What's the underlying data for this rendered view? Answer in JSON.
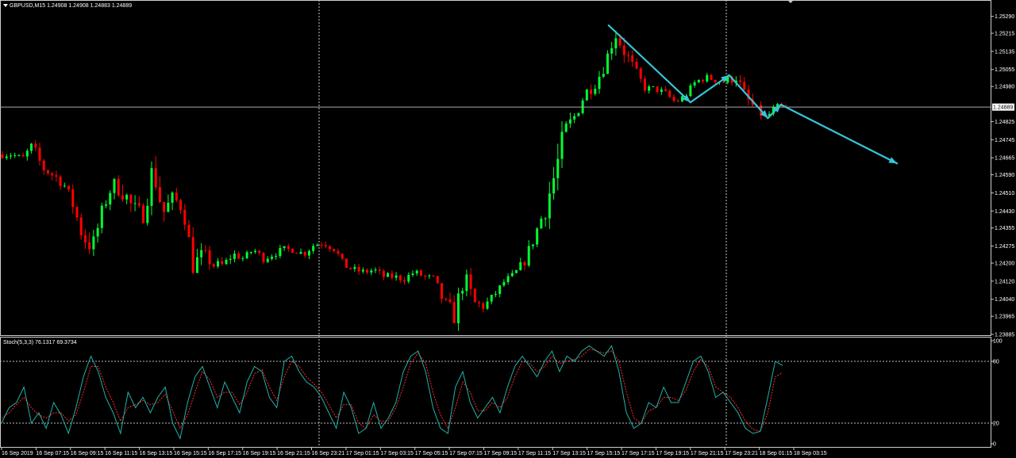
{
  "header": {
    "symbol_info": "GBPUSD,M15  1.24908 1.24908 1.24883 1.24889"
  },
  "current_price": {
    "label": "1.24889",
    "value": 1.24889
  },
  "colors": {
    "background": "#000000",
    "bull": "#00ff33",
    "bear": "#ff0000",
    "grid": "#c8c8c8",
    "axis_text": "#ffffff",
    "annotation": "#36c5d8",
    "stoch_main": "#20b2aa",
    "stoch_signal": "#ff2a2a"
  },
  "chart_data": [
    {
      "type": "candlestick",
      "symbol": "GBPUSD",
      "timeframe": "M15",
      "ohlc_header": {
        "open": 1.24908,
        "high": 1.24908,
        "low": 1.24883,
        "close": 1.24889
      },
      "ylim": [
        1.23885,
        1.2532
      ],
      "price_ticks": [
        "1.25290",
        "1.25215",
        "1.25135",
        "1.25055",
        "1.24980",
        "1.24825",
        "1.24745",
        "1.24665",
        "1.24590",
        "1.24510",
        "1.24430",
        "1.24355",
        "1.24275",
        "1.24200",
        "1.24120",
        "1.24040",
        "1.23965",
        "1.23885"
      ],
      "time_labels": [
        "16 Sep 2019",
        "16 Sep 07:15",
        "16 Sep 09:15",
        "16 Sep 11:15",
        "16 Sep 13:15",
        "16 Sep 15:15",
        "16 Sep 17:15",
        "16 Sep 19:15",
        "16 Sep 21:15",
        "16 Sep 23:21",
        "17 Sep 01:15",
        "17 Sep 03:15",
        "17 Sep 05:15",
        "17 Sep 07:15",
        "17 Sep 09:15",
        "17 Sep 11:15",
        "17 Sep 13:15",
        "17 Sep 15:15",
        "17 Sep 17:15",
        "17 Sep 19:15",
        "17 Sep 21:15",
        "17 Sep 23:21",
        "18 Sep 01:15",
        "18 Sep 03:15"
      ],
      "close_path": [
        1.2468,
        1.2468,
        1.2466,
        1.2472,
        1.2462,
        1.2459,
        1.2456,
        1.2446,
        1.2432,
        1.2427,
        1.2444,
        1.2455,
        1.2452,
        1.2444,
        1.2441,
        1.2462,
        1.2442,
        1.2449,
        1.2444,
        1.2419,
        1.2424,
        1.2419,
        1.2419,
        1.2424,
        1.2422,
        1.2426,
        1.2422,
        1.2424,
        1.2426,
        1.2426,
        1.2424,
        1.2428,
        1.2429,
        1.2427,
        1.2419,
        1.2417,
        1.2416,
        1.2417,
        1.2414,
        1.2414,
        1.2413,
        1.2416,
        1.2414,
        1.2413,
        1.2402,
        1.2397,
        1.2414,
        1.2402,
        1.2401,
        1.2406,
        1.2412,
        1.2415,
        1.2421,
        1.2432,
        1.2444,
        1.2459,
        1.2477,
        1.2485,
        1.2495,
        1.2499,
        1.2508,
        1.2522,
        1.2513,
        1.2505,
        1.2497,
        1.2497,
        1.2495,
        1.2491,
        1.2494,
        1.25,
        1.2502,
        1.2501,
        1.25,
        1.2503,
        1.2493,
        1.2488,
        1.2484,
        1.2489,
        1.2489
      ],
      "volatility": [
        2,
        2,
        2,
        3,
        3,
        3,
        4,
        4,
        6,
        6,
        4,
        4,
        6,
        5,
        5,
        8,
        6,
        4,
        4,
        6,
        4,
        3,
        3,
        2,
        2,
        2,
        2,
        2,
        2,
        2,
        2,
        2,
        2,
        3,
        2,
        2,
        2,
        2,
        2,
        2,
        2,
        2,
        2,
        2,
        4,
        6,
        5,
        5,
        3,
        2,
        2,
        2,
        3,
        4,
        7,
        9,
        8,
        4,
        4,
        3,
        4,
        5,
        5,
        3,
        2,
        2,
        2,
        2,
        2,
        2,
        2,
        2,
        3,
        4,
        4,
        3,
        2,
        2,
        1
      ],
      "candle_count": 190
    },
    {
      "type": "line",
      "indicator": "Stochastic",
      "title": "Stoch(5,3,3) 76.1317 69.3734",
      "params": [
        5,
        3,
        3
      ],
      "main_value": 76.1317,
      "signal_value": 69.3734,
      "ylim": [
        0,
        100
      ],
      "levels": [
        20,
        80
      ],
      "tick_labels": [
        "100",
        "80",
        "20",
        "0"
      ],
      "main_series": [
        20,
        35,
        40,
        55,
        20,
        30,
        15,
        40,
        28,
        10,
        35,
        65,
        85,
        70,
        45,
        30,
        10,
        50,
        35,
        45,
        30,
        45,
        55,
        20,
        5,
        40,
        65,
        75,
        55,
        35,
        60,
        45,
        30,
        60,
        75,
        70,
        45,
        35,
        80,
        85,
        70,
        60,
        55,
        45,
        30,
        15,
        50,
        35,
        10,
        15,
        40,
        15,
        25,
        40,
        70,
        85,
        90,
        70,
        35,
        15,
        10,
        55,
        70,
        40,
        25,
        35,
        45,
        30,
        55,
        75,
        85,
        75,
        65,
        80,
        90,
        70,
        85,
        80,
        90,
        95,
        90,
        85,
        95,
        70,
        30,
        15,
        20,
        40,
        35,
        55,
        40,
        40,
        60,
        80,
        85,
        70,
        45,
        50,
        40,
        30,
        15,
        10,
        12,
        45,
        80,
        76
      ],
      "signal_series": [
        25,
        30,
        38,
        45,
        35,
        28,
        25,
        30,
        30,
        22,
        28,
        50,
        75,
        75,
        55,
        40,
        22,
        35,
        38,
        42,
        38,
        40,
        48,
        32,
        15,
        28,
        50,
        70,
        62,
        45,
        50,
        50,
        38,
        50,
        68,
        72,
        55,
        42,
        65,
        80,
        75,
        65,
        58,
        50,
        38,
        25,
        38,
        38,
        20,
        15,
        28,
        22,
        22,
        35,
        55,
        78,
        88,
        78,
        50,
        28,
        15,
        35,
        60,
        50,
        32,
        32,
        40,
        35,
        45,
        65,
        80,
        78,
        70,
        75,
        85,
        78,
        80,
        82,
        85,
        92,
        90,
        88,
        90,
        80,
        50,
        25,
        20,
        32,
        35,
        45,
        45,
        42,
        52,
        70,
        82,
        75,
        55,
        50,
        45,
        35,
        22,
        14,
        12,
        30,
        65,
        69
      ]
    }
  ],
  "annotations": {
    "arrows": [
      {
        "from": [
          "17 Sep 16:30",
          1.2525
        ],
        "to": [
          "17 Sep 21:15",
          1.2491
        ]
      },
      {
        "from": [
          "17 Sep 21:15",
          1.2491
        ],
        "to": [
          "17 Sep 23:30",
          1.2503
        ]
      },
      {
        "from": [
          "17 Sep 23:30",
          1.2503
        ],
        "to": [
          "18 Sep 01:45",
          1.2484
        ]
      },
      {
        "from": [
          "18 Sep 01:45",
          1.2484
        ],
        "to": [
          "18 Sep 02:30",
          1.249
        ]
      },
      {
        "from": [
          "18 Sep 02:30",
          1.249
        ],
        "to": [
          "18 Sep 09:15",
          1.2464
        ]
      }
    ]
  }
}
